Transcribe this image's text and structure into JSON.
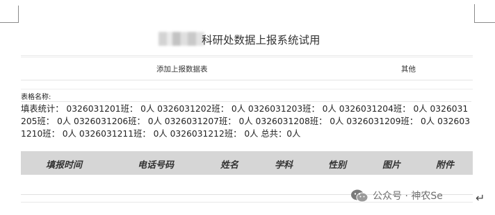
{
  "page": {
    "title_suffix": "科研处数据上报系统试用",
    "title_redacted": true
  },
  "tabs": {
    "add_report": "添加上报数据表",
    "other": "其他"
  },
  "form": {
    "table_name_label": "表格名称:"
  },
  "stats": {
    "text": "填表统计： 0326031201班： 0人 0326031202班： 0人 0326031203班： 0人 0326031204班： 0人 0326031205班： 0人 0326031206班： 0人 0326031207班： 0人 0326031208班： 0人 0326031209班： 0人 0326031210班： 0人 0326031211班： 0人 0326031212班： 0人 总共：0人"
  },
  "table": {
    "headers": [
      "填报时间",
      "电话号码",
      "姓名",
      "学科",
      "性别",
      "图片",
      "附件"
    ]
  },
  "watermark": {
    "text": "公众号 · 神农Se"
  },
  "icons": {
    "watermark": "wechat-icon",
    "paragraph_mark": "return-arrow-icon"
  }
}
